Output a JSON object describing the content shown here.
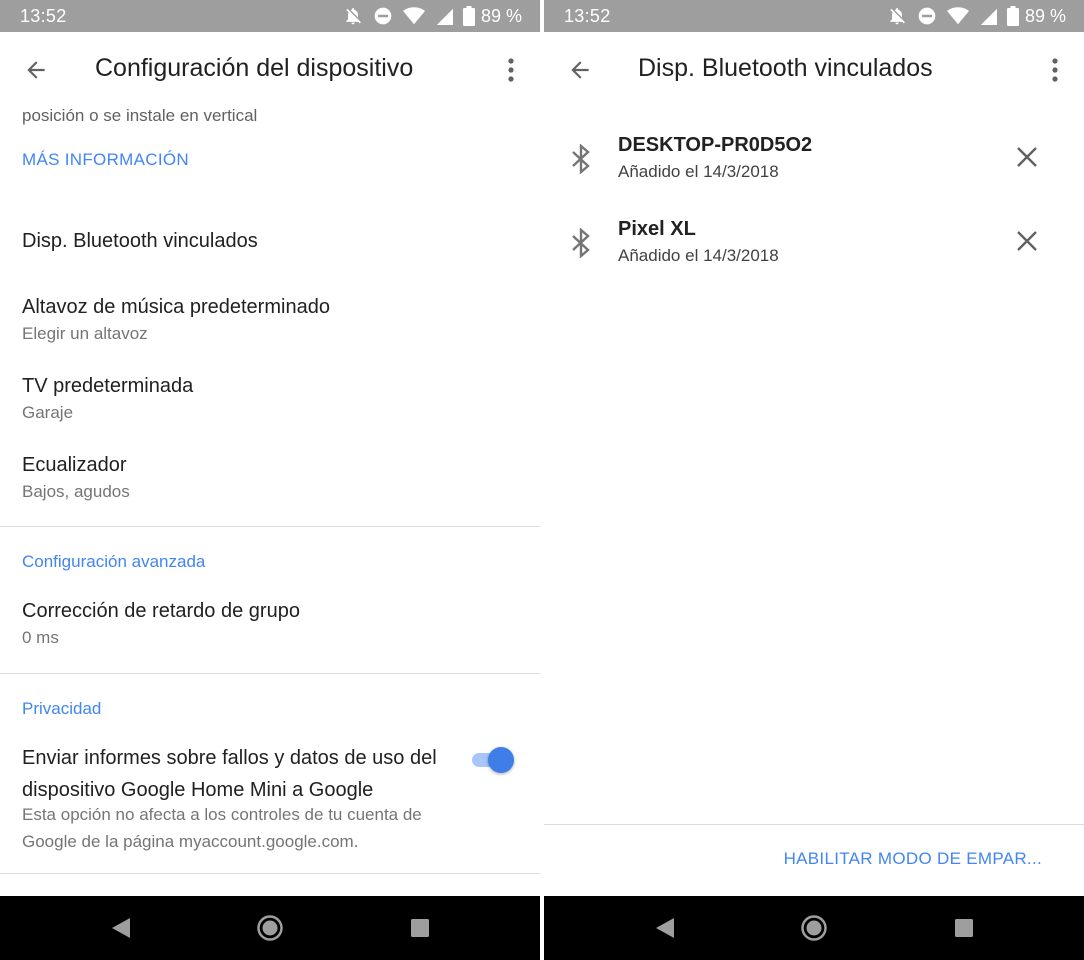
{
  "status_bar": {
    "time": "13:52",
    "battery": "89 %"
  },
  "left_screen": {
    "title": "Configuración del dispositivo",
    "partial_text": "posición o se instale en vertical",
    "more_info_link": "MÁS INFORMACIÓN",
    "items": [
      {
        "title": "Disp. Bluetooth vinculados",
        "subtitle": ""
      },
      {
        "title": "Altavoz de música predeterminado",
        "subtitle": "Elegir un altavoz"
      },
      {
        "title": "TV predeterminada",
        "subtitle": "Garaje"
      },
      {
        "title": "Ecualizador",
        "subtitle": "Bajos, agudos"
      }
    ],
    "advanced": {
      "header": "Configuración avanzada",
      "item": {
        "title": "Corrección de retardo de grupo",
        "subtitle": "0 ms"
      }
    },
    "privacy": {
      "header": "Privacidad",
      "title": "Enviar informes sobre fallos y datos de uso del dispositivo Google Home Mini a Google",
      "subtitle": "Esta opción no afecta a los controles de tu cuenta de Google de la página myaccount.google.com.",
      "toggle_on": true
    }
  },
  "right_screen": {
    "title": "Disp. Bluetooth vinculados",
    "devices": [
      {
        "name": "DESKTOP-PR0D5O2",
        "added": "Añadido el 14/3/2018"
      },
      {
        "name": "Pixel XL",
        "added": "Añadido el 14/3/2018"
      }
    ],
    "pair_button": "HABILITAR MODO DE EMPAR..."
  },
  "icons": {
    "status": [
      "notifications-off-icon",
      "do-not-disturb-icon",
      "wifi-icon",
      "cell-signal-icon",
      "battery-icon"
    ],
    "app_bar": [
      "back-arrow-icon",
      "more-vert-icon"
    ],
    "list": [
      "bluetooth-icon",
      "close-icon"
    ],
    "nav": [
      "nav-back-icon",
      "nav-home-icon",
      "nav-recents-icon"
    ]
  },
  "colors": {
    "accent": "#4285f4",
    "status_bar": "#9e9e9e",
    "toggle_thumb": "#3f7ee8",
    "toggle_track": "#a9c5f9",
    "nav_bar": "#000000"
  }
}
